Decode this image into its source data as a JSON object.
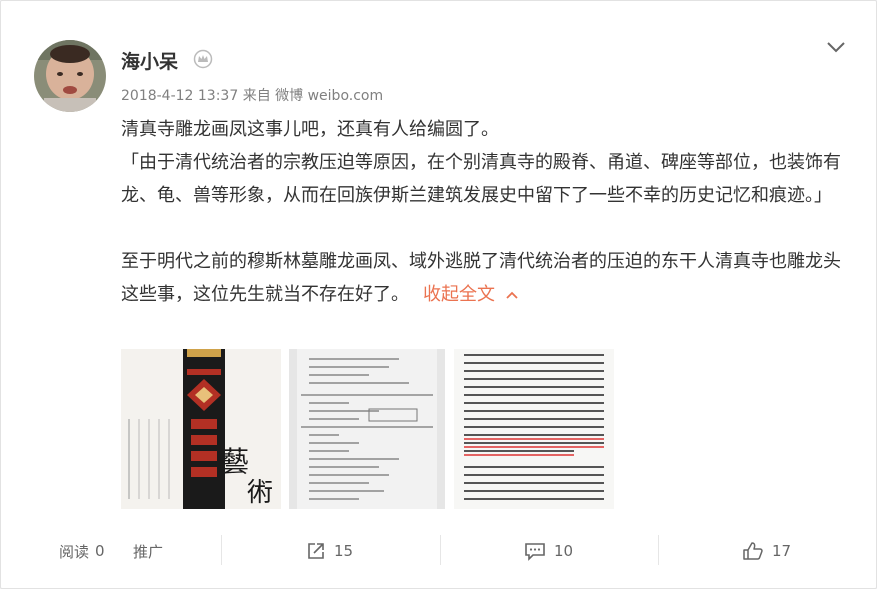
{
  "user": {
    "name": "海小呆",
    "meta": "2018-4-12 13:37 来自 微博 weibo.com"
  },
  "post": {
    "line1": "清真寺雕龙画凤这事儿吧，还真有人给编圆了。",
    "quote": "「由于清代统治者的宗教压迫等原因，在个别清真寺的殿脊、甬道、碑座等部位，也装饰有龙、龟、兽等形象，从而在回族伊斯兰建筑发展史中留下了一些不幸的历史记忆和痕迹。」",
    "line3": "至于明代之前的穆斯林墓雕龙画凤、域外逃脱了清代统治者的压迫的东干人清真寺也雕龙头这些事，这位先生就当不存在好了。",
    "collapse_label": "收起全文"
  },
  "images": {
    "book_cover_char1": "藝",
    "book_cover_char2": "術"
  },
  "footer": {
    "read_label": "阅读",
    "read_count": "0",
    "promote_label": "推广",
    "repost_count": "15",
    "comment_count": "10",
    "like_count": "17"
  },
  "colors": {
    "accent": "#eb7350",
    "text": "#333333",
    "meta": "#808080"
  },
  "icons": [
    "chevron-down-icon",
    "crown-icon",
    "repost-icon",
    "comment-icon",
    "like-icon",
    "chevron-up-icon"
  ]
}
